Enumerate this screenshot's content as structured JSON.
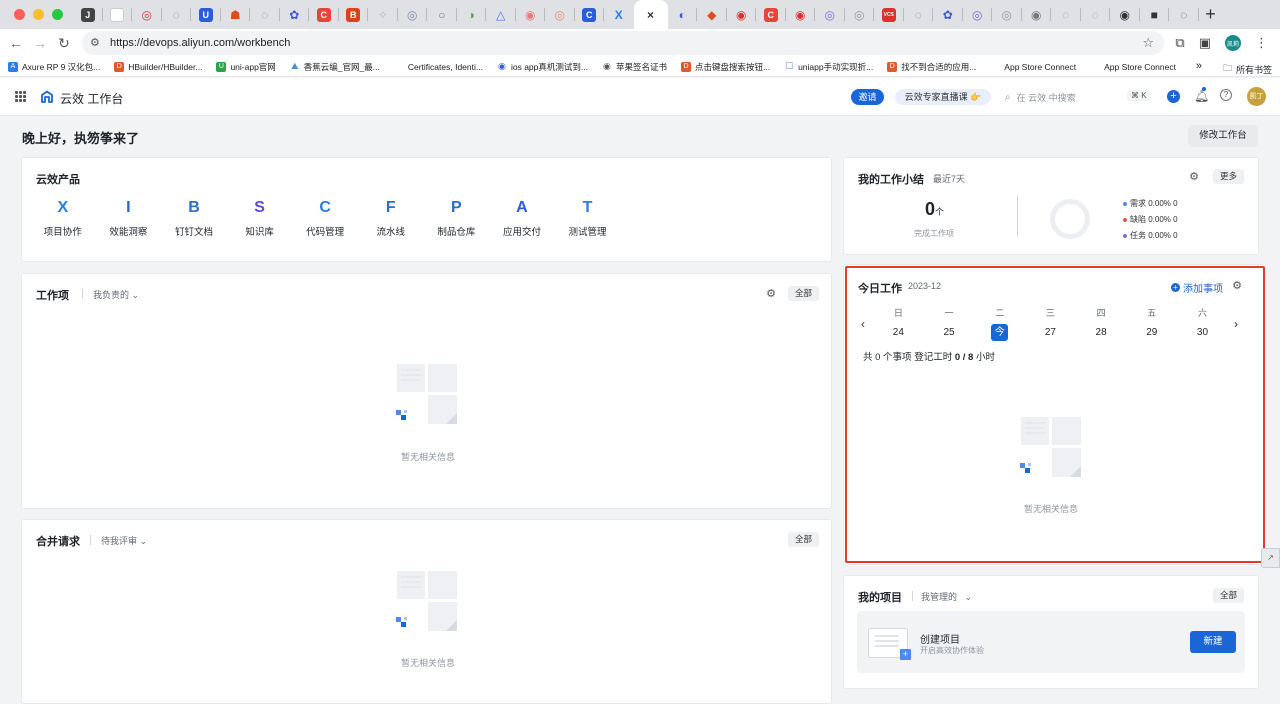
{
  "browser": {
    "tabs": [
      {
        "icon": "J",
        "color": "#444"
      },
      {
        "icon": "",
        "color": "#ffffff"
      },
      {
        "icon": "◎",
        "color": "#d33"
      },
      {
        "icon": "◌",
        "color": "#888"
      },
      {
        "icon": "U",
        "color": "#2b5dd6"
      },
      {
        "icon": "☗",
        "color": "#e04a1f"
      },
      {
        "icon": "◌",
        "color": "#888"
      },
      {
        "icon": "✿",
        "color": "#3b5bd1"
      },
      {
        "icon": "C",
        "color": "#e8443a"
      },
      {
        "icon": "B",
        "color": "#d8431b"
      },
      {
        "icon": "✧",
        "color": "#bbb"
      },
      {
        "icon": "◎",
        "color": "#7c8db0"
      },
      {
        "icon": "○",
        "color": "#777"
      },
      {
        "icon": "◑",
        "color": "#5aa24c"
      },
      {
        "icon": "△",
        "color": "#3b7be8"
      },
      {
        "icon": "◉",
        "color": "#e47a7a"
      },
      {
        "icon": "◎",
        "color": "#e89072"
      },
      {
        "icon": "C",
        "color": "#2b5dd6"
      },
      {
        "icon": "X",
        "color": "#2b7de9"
      },
      {
        "icon": "×",
        "color": "#333"
      },
      {
        "icon": "◐",
        "color": "#2b5dd6"
      },
      {
        "icon": "◆",
        "color": "#e04a1f"
      },
      {
        "icon": "◉",
        "color": "#e0302a"
      },
      {
        "icon": "C",
        "color": "#e8443a"
      },
      {
        "icon": "◉",
        "color": "#e0302a"
      },
      {
        "icon": "◎",
        "color": "#7c6dd8"
      },
      {
        "icon": "◎",
        "color": "#999"
      },
      {
        "icon": "VCS",
        "color": "#d9342b"
      },
      {
        "icon": "◌",
        "color": "#888"
      },
      {
        "icon": "✿",
        "color": "#3b5bd1"
      },
      {
        "icon": "◎",
        "color": "#7c6dd8"
      },
      {
        "icon": "◎",
        "color": "#999"
      },
      {
        "icon": "◉",
        "color": "#777"
      },
      {
        "icon": "◌",
        "color": "#999"
      },
      {
        "icon": "◌",
        "color": "#999"
      },
      {
        "icon": "◉",
        "color": "#333"
      },
      {
        "icon": "■",
        "color": "#333"
      },
      {
        "icon": "◌",
        "color": "#555"
      }
    ],
    "new_tab": "+",
    "url": "https://devops.aliyun.com/workbench",
    "profile_label": "凯莉",
    "bookmarks": [
      {
        "label": "Axure RP 9 汉化包...",
        "icon": "A",
        "color": "#2b7de9"
      },
      {
        "label": "HBuilder/HBuilder...",
        "icon": "D",
        "color": "#e05a2b"
      },
      {
        "label": "uni-app官网",
        "icon": "U",
        "color": "#2ca54a"
      },
      {
        "label": "香蕉云编_官网_最...",
        "icon": "⛰",
        "color": "#4a90d9"
      },
      {
        "label": "Certificates, Identi...",
        "icon": "",
        "color": "#333"
      },
      {
        "label": "ios app真机测试到...",
        "icon": "◉",
        "color": "#2b5dd6"
      },
      {
        "label": "苹果签名证书",
        "icon": "◉",
        "color": "#555"
      },
      {
        "label": "点击键盘搜索按钮...",
        "icon": "D",
        "color": "#e05a2b"
      },
      {
        "label": "uniapp手动实现折...",
        "icon": "☐",
        "color": "#5a8fd6"
      },
      {
        "label": "找不到合适的应用...",
        "icon": "D",
        "color": "#e05a2b"
      },
      {
        "label": "App Store Connect",
        "icon": "",
        "color": "#333"
      },
      {
        "label": "App Store Connect",
        "icon": "",
        "color": "#333"
      }
    ],
    "bookmarks_more": "»",
    "all_bookmarks": "所有书签"
  },
  "header": {
    "app_title": "云效 工作台",
    "invite": "邀请",
    "live_course": "云效专家直播课 👉",
    "search_placeholder": "在 云效 中搜索",
    "shortcut": "⌘ K",
    "avatar": "凯丁",
    "brand_color": "#1b66d6"
  },
  "main": {
    "greeting": "晚上好，执笏筝来了",
    "modify_button": "修改工作台"
  },
  "products": {
    "title": "云效产品",
    "items": [
      {
        "label": "项目协作",
        "icon": "X"
      },
      {
        "label": "效能洞察",
        "icon": "I"
      },
      {
        "label": "钉钉文档",
        "icon": "B"
      },
      {
        "label": "知识库",
        "icon": "S"
      },
      {
        "label": "代码管理",
        "icon": "C"
      },
      {
        "label": "流水线",
        "icon": "F"
      },
      {
        "label": "制品仓库",
        "icon": "P"
      },
      {
        "label": "应用交付",
        "icon": "A"
      },
      {
        "label": "测试管理",
        "icon": "T"
      }
    ]
  },
  "work_items": {
    "title": "工作项",
    "filter": "我负责的",
    "all": "全部",
    "empty": "暂无相关信息"
  },
  "merge_requests": {
    "title": "合并请求",
    "filter": "待我评审",
    "all": "全部",
    "empty": "暂无相关信息"
  },
  "summary": {
    "title": "我的工作小结",
    "period": "最近7天",
    "more": "更多",
    "count": "0",
    "unit": "个",
    "completed_label": "完成工作项",
    "legend": [
      {
        "label": "需求 0.00% 0",
        "color": "#4d8af0"
      },
      {
        "label": "缺陷 0.00% 0",
        "color": "#e5534b"
      },
      {
        "label": "任务 0.00% 0",
        "color": "#7c6dd8"
      }
    ]
  },
  "today": {
    "title": "今日工作",
    "month": "2023-12",
    "add_item": "添加事项",
    "prev": "‹",
    "next": "›",
    "days": [
      {
        "weekday": "日",
        "date": "24"
      },
      {
        "weekday": "一",
        "date": "25"
      },
      {
        "weekday": "二",
        "date": "今",
        "today": true
      },
      {
        "weekday": "三",
        "date": "27"
      },
      {
        "weekday": "四",
        "date": "28"
      },
      {
        "weekday": "五",
        "date": "29"
      },
      {
        "weekday": "六",
        "date": "30"
      }
    ],
    "summary_prefix": "共 0 个事项  登记工时 ",
    "hours": "0 / 8",
    "hours_unit": " 小时",
    "empty": "暂无相关信息",
    "highlight_color": "#e03c2c"
  },
  "projects": {
    "title": "我的项目",
    "filter": "我管理的",
    "all": "全部",
    "create_title": "创建项目",
    "create_desc": "开启高效协作体验",
    "new_button": "新建"
  }
}
